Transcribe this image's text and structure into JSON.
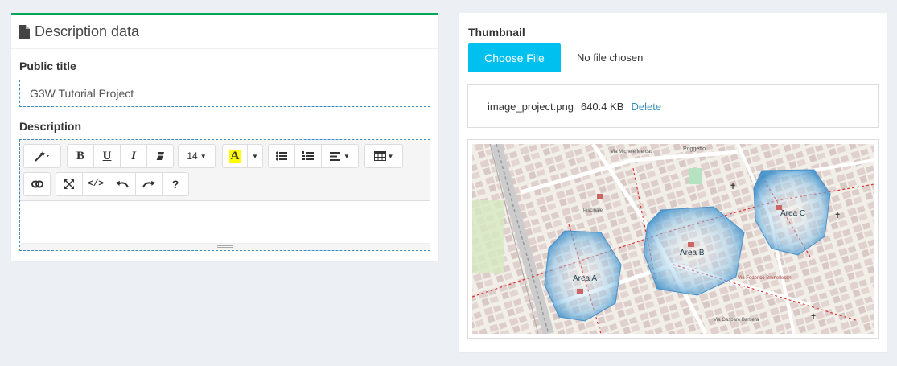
{
  "description_box": {
    "title": "Description data",
    "public_title_label": "Public title",
    "public_title_value": "G3W Tutorial Project",
    "description_label": "Description",
    "editor": {
      "font_size": "14",
      "bold": "B",
      "underline": "U",
      "italic": "I",
      "help": "?"
    }
  },
  "thumbnail_box": {
    "label": "Thumbnail",
    "choose_file": "Choose File",
    "no_file": "No file chosen",
    "file_name": "image_project.png",
    "file_size": "640.4 KB",
    "delete": "Delete",
    "map": {
      "areas": [
        "Area A",
        "Area B",
        "Area C"
      ],
      "streets": [
        "Via Michele Mercati",
        "Poggetto",
        "Piazza Elia Dalla Costa",
        "Piscinale",
        "Via Gaspare Barbera",
        "Via Federico Brunelleschi",
        "Via Gianfrancesco Roncalli"
      ]
    }
  },
  "colors": {
    "accent_green": "#00a65a",
    "button_blue": "#00c0ef",
    "link_blue": "#3c8dbc",
    "editor_border": "#3c8dbc",
    "area_fill": "#6aaed6"
  }
}
